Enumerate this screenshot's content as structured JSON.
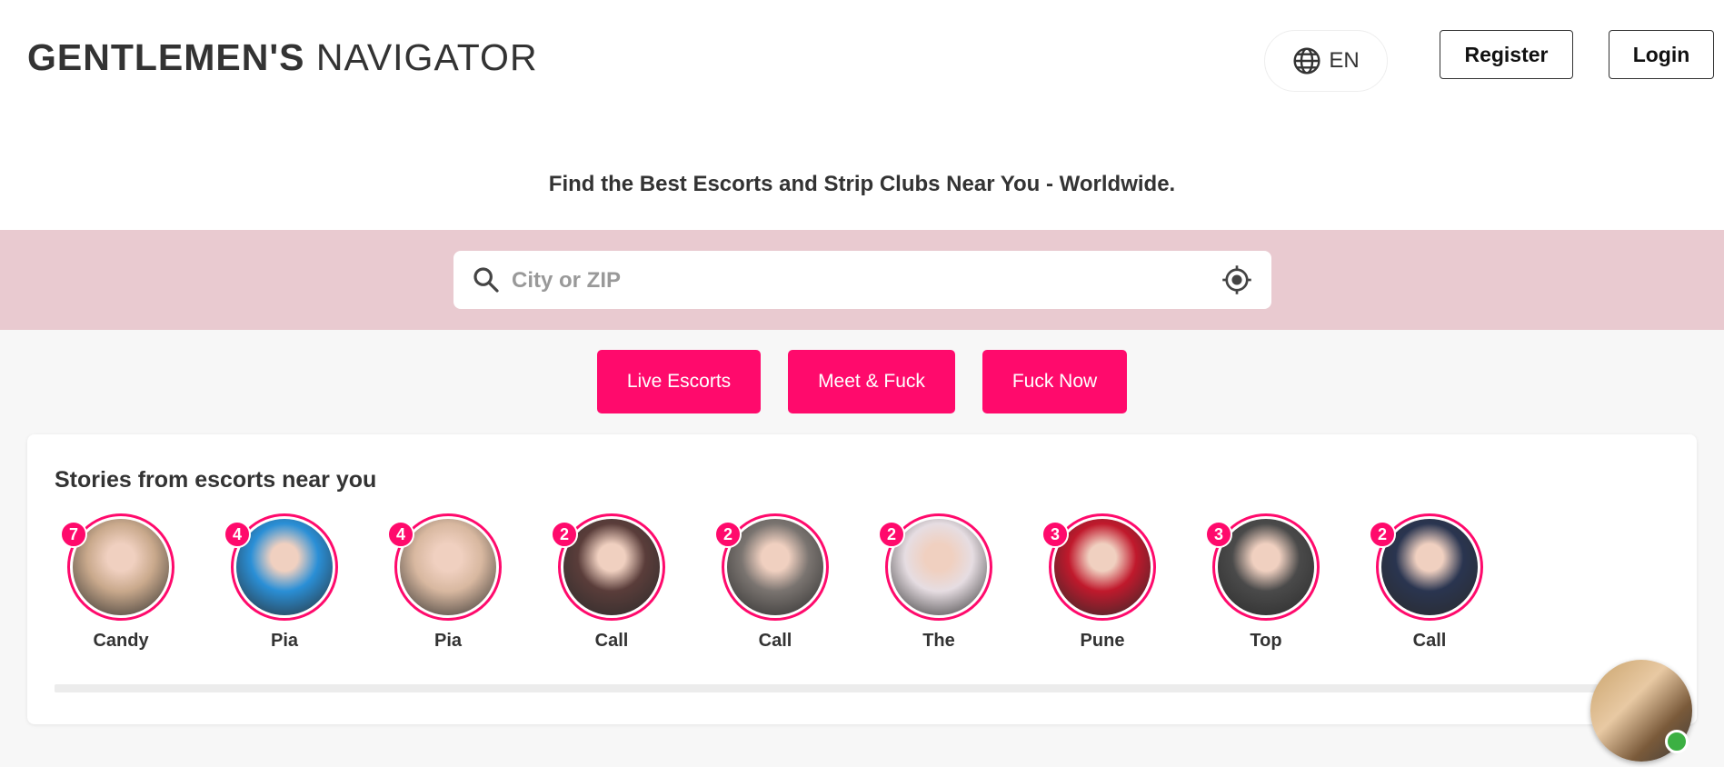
{
  "header": {
    "logo_bold": "GENTLEMEN'S",
    "logo_regular": "NAVIGATOR",
    "language": "EN",
    "register_label": "Register",
    "login_label": "Login"
  },
  "tagline": "Find the Best Escorts and Strip Clubs Near You - Worldwide.",
  "search": {
    "placeholder": "City or ZIP",
    "value": ""
  },
  "cta_buttons": [
    "Live Escorts",
    "Meet & Fuck",
    "Fuck Now"
  ],
  "stories": {
    "title": "Stories from escorts near you",
    "items": [
      {
        "name": "Candy",
        "count": "7",
        "color": "#c9a98c"
      },
      {
        "name": "Pia",
        "count": "4",
        "color": "#2a8fd6"
      },
      {
        "name": "Pia",
        "count": "4",
        "color": "#d8b8a0"
      },
      {
        "name": "Call",
        "count": "2",
        "color": "#5a3d3a"
      },
      {
        "name": "Call",
        "count": "2",
        "color": "#7a7470"
      },
      {
        "name": "The",
        "count": "2",
        "color": "#e6dde2"
      },
      {
        "name": "Pune",
        "count": "3",
        "color": "#c0192c"
      },
      {
        "name": "Top",
        "count": "3",
        "color": "#4a4a4a"
      },
      {
        "name": "Call",
        "count": "2",
        "color": "#2a3550"
      }
    ]
  },
  "colors": {
    "accent": "#ff0a6c",
    "search_band": "#e9cad0"
  },
  "icons": {
    "language": "globe-icon",
    "search": "search-icon",
    "locate": "crosshair-icon",
    "chat": "chat-avatar",
    "online": "online-status-dot"
  }
}
